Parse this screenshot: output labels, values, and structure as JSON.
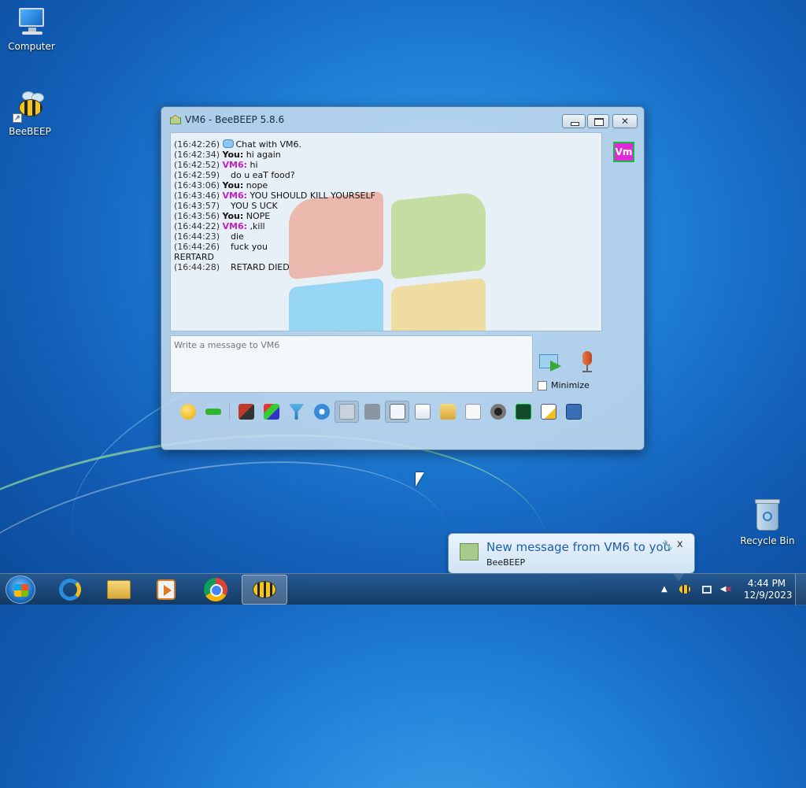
{
  "desktop": {
    "icons": [
      {
        "label": "Computer"
      },
      {
        "label": "BeeBEEP"
      },
      {
        "label": "Recycle Bin"
      }
    ]
  },
  "window": {
    "title": "VM6 - BeeBEEP 5.8.6",
    "messages": [
      {
        "ts": "(16:42:26)",
        "sender": "",
        "text": "Chat with VM6."
      },
      {
        "ts": "(16:42:34)",
        "sender": "You:",
        "text": "hi again"
      },
      {
        "ts": "(16:42:52)",
        "sender": "VM6:",
        "text": "hi"
      },
      {
        "ts": "(16:42:59)",
        "sender": "",
        "text": "do u eaT food?"
      },
      {
        "ts": "(16:43:06)",
        "sender": "You:",
        "text": "nope"
      },
      {
        "ts": "(16:43:46)",
        "sender": "VM6:",
        "text": "YOU SHOULD KILL YOURSELF"
      },
      {
        "ts": "(16:43:57)",
        "sender": "",
        "text": "YOU S UCK"
      },
      {
        "ts": "(16:43:56)",
        "sender": "You:",
        "text": "NOPE"
      },
      {
        "ts": "(16:44:22)",
        "sender": "VM6:",
        "text": ",kill"
      },
      {
        "ts": "(16:44:23)",
        "sender": "",
        "text": "die"
      },
      {
        "ts": "(16:44:26)",
        "sender": "",
        "text": "fuck you"
      },
      {
        "ts": "",
        "sender": "",
        "text": "RERTARD"
      },
      {
        "ts": "(16:44:28)",
        "sender": "",
        "text": "RETARD DIED"
      }
    ],
    "input_placeholder": "Write a message to VM6",
    "minimize_label": "Minimize",
    "avatar_initials": "Vm",
    "colors": {
      "peer": "#c020c0",
      "avatar_bg": "#e02ad8",
      "avatar_border": "#1bb94a"
    },
    "toolbar_icons": [
      "emoticon-icon",
      "green-arrow-icon",
      "font-icon",
      "color-pen-icon",
      "filter-icon",
      "settings-gear-icon",
      "spell-check-icon",
      "font-style-icon",
      "music-note-icon",
      "send-file-icon",
      "send-folder-icon",
      "code-icon",
      "screenshot-icon",
      "terminal-icon",
      "notes-icon",
      "save-icon"
    ]
  },
  "notification": {
    "title": "New message from VM6 to you",
    "subtitle": "BeeBEEP",
    "close_glyph": "x"
  },
  "taskbar": {
    "apps": [
      "internet-explorer",
      "file-explorer",
      "media-player",
      "chrome",
      "beebeep"
    ],
    "clock_time": "4:44 PM",
    "clock_date": "12/9/2023"
  }
}
